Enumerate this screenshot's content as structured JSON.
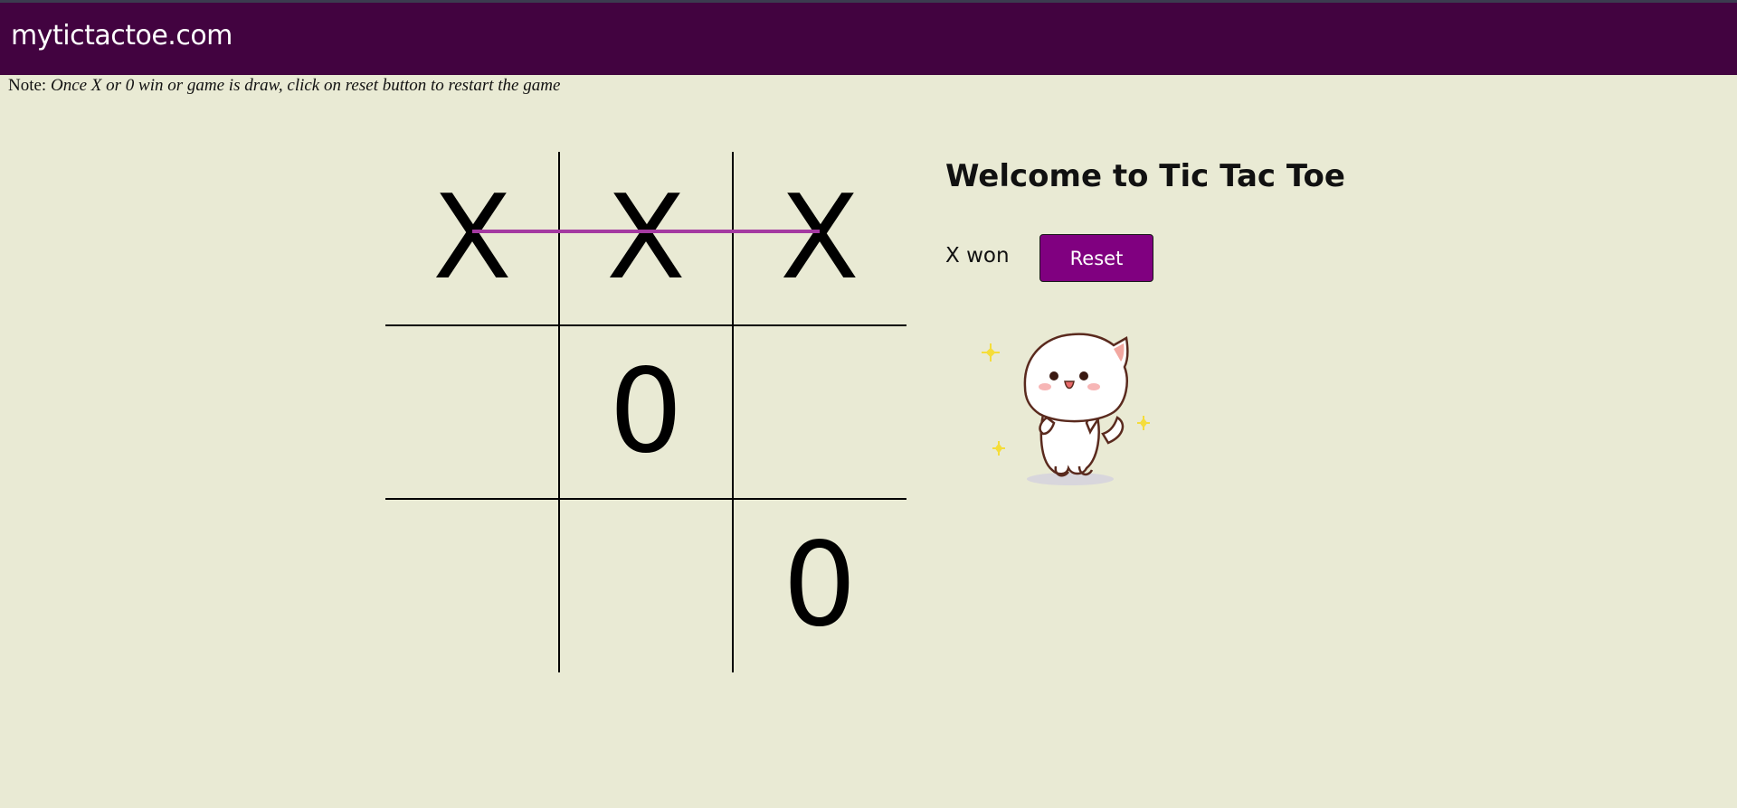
{
  "brand": {
    "name": "mytictactoe.com"
  },
  "note": {
    "prefix": "Note:",
    "text": "Once X or 0 win or game is draw, click on reset button to restart the game"
  },
  "board": {
    "cells": [
      "X",
      "X",
      "X",
      "",
      "0",
      "",
      "",
      "",
      "0"
    ],
    "winning_line": {
      "cells": [
        0,
        1,
        2
      ],
      "color": "#a43aa1"
    }
  },
  "panel": {
    "title": "Welcome to Tic Tac Toe",
    "status": "X won",
    "reset_label": "Reset"
  },
  "celebration": {
    "icon": "dancing-cat-sticker-icon"
  },
  "colors": {
    "navbar": "#420340",
    "background": "#e9ead4",
    "accent_button": "#800080",
    "winning_line": "#a43aa1"
  }
}
